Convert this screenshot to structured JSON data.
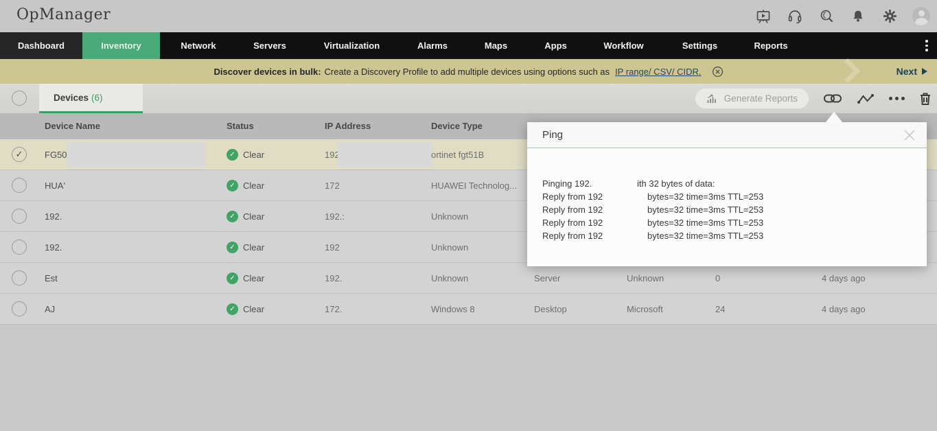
{
  "app": {
    "logo": "OpManager"
  },
  "nav": {
    "items": [
      {
        "label": "Dashboard",
        "active": false
      },
      {
        "label": "Inventory",
        "active": true
      },
      {
        "label": "Network",
        "active": false
      },
      {
        "label": "Servers",
        "active": false
      },
      {
        "label": "Virtualization",
        "active": false
      },
      {
        "label": "Alarms",
        "active": false
      },
      {
        "label": "Maps",
        "active": false
      },
      {
        "label": "Apps",
        "active": false
      },
      {
        "label": "Workflow",
        "active": false
      },
      {
        "label": "Settings",
        "active": false
      },
      {
        "label": "Reports",
        "active": false
      }
    ]
  },
  "banner": {
    "bold_text": "Discover devices in bulk:",
    "text": "Create a Discovery Profile to add multiple devices using options such as",
    "link_text": "IP range/ CSV/ CIDR.",
    "next_label": "Next"
  },
  "toolbar": {
    "tab_label": "Devices",
    "tab_count": "(6)",
    "generate_reports_label": "Generate Reports"
  },
  "table": {
    "columns": [
      "Device Name",
      "Status",
      "IP Address",
      "Device Type"
    ],
    "rows": [
      {
        "name": "FG50",
        "status": "Clear",
        "ip": "192",
        "type": "ortinet fgt51B",
        "category": "",
        "vendor": "",
        "count": "",
        "age": "",
        "selected": true
      },
      {
        "name": "HUA'",
        "status": "Clear",
        "ip": "172",
        "type": "HUAWEI Technolog...",
        "category": "",
        "vendor": "",
        "count": "",
        "age": "",
        "selected": false
      },
      {
        "name": "192.",
        "status": "Clear",
        "ip": "192.:",
        "type": "Unknown",
        "category": "",
        "vendor": "",
        "count": "",
        "age": "",
        "selected": false
      },
      {
        "name": "192.",
        "status": "Clear",
        "ip": "192",
        "type": "Unknown",
        "category": "",
        "vendor": "",
        "count": "",
        "age": "",
        "selected": false
      },
      {
        "name": "Est",
        "status": "Clear",
        "ip": "192.",
        "type": "Unknown",
        "category": "Server",
        "vendor": "Unknown",
        "count": "0",
        "age": "4 days ago",
        "selected": false
      },
      {
        "name": "AJ",
        "status": "Clear",
        "ip": "172.",
        "type": "Windows 8",
        "category": "Desktop",
        "vendor": "Microsoft",
        "count": "24",
        "age": "4 days ago",
        "selected": false
      }
    ]
  },
  "ping_dialog": {
    "title": "Ping",
    "lines": [
      {
        "left": "Pinging 192.",
        "right": "ith 32 bytes of data:"
      },
      {
        "left": "Reply from 192",
        "right": "bytes=32 time=3ms TTL=253"
      },
      {
        "left": "Reply from 192",
        "right": "bytes=32 time=3ms TTL=253"
      },
      {
        "left": "Reply from 192",
        "right": "bytes=32 time=3ms TTL=253"
      },
      {
        "left": "Reply from 192",
        "right": "bytes=32 time=3ms TTL=253"
      }
    ]
  },
  "colors": {
    "accent_green": "#4aa978",
    "status_green": "#41a466",
    "tab_underline_green": "#3f9e63",
    "banner_bg": "#cdc592",
    "banner_link": "#1c4a60",
    "selected_row": "#e0ddc4"
  }
}
